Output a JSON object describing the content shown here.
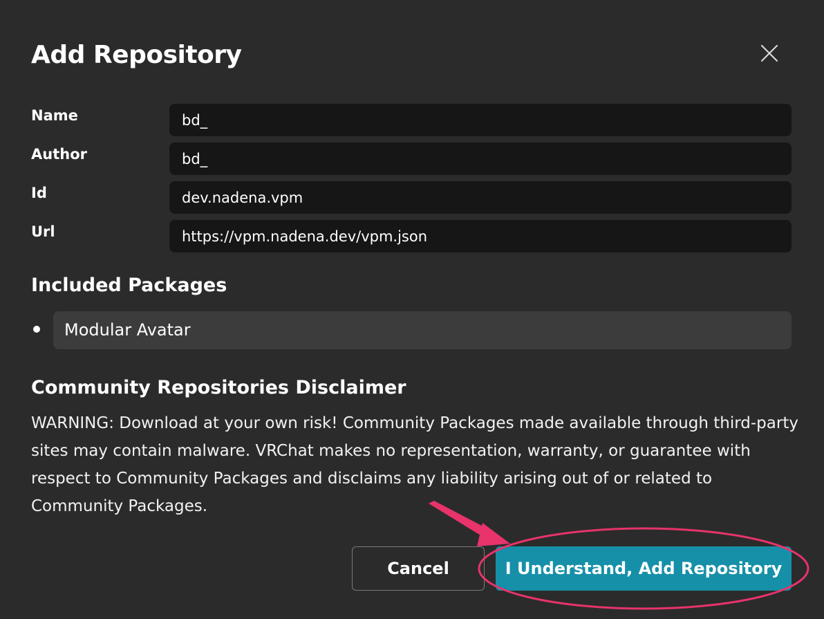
{
  "dialog": {
    "title": "Add Repository",
    "close_icon": "close-icon"
  },
  "fields": [
    {
      "label": "Name",
      "value": "bd_"
    },
    {
      "label": "Author",
      "value": "bd_"
    },
    {
      "label": "Id",
      "value": "dev.nadena.vpm"
    },
    {
      "label": "Url",
      "value": "https://vpm.nadena.dev/vpm.json"
    }
  ],
  "packages": {
    "heading": "Included Packages",
    "items": [
      "Modular Avatar"
    ]
  },
  "disclaimer": {
    "heading": "Community Repositories Disclaimer",
    "text": "WARNING: Download at your own risk! Community Packages made available through third-party sites may contain malware. VRChat makes no representation, warranty, or guarantee with respect to Community Packages and disclaims any liability arising out of or related to Community Packages."
  },
  "buttons": {
    "cancel": "Cancel",
    "confirm": "I Understand, Add Repository"
  },
  "colors": {
    "background": "#2b2b2b",
    "input_background": "#161616",
    "package_background": "#3c3c3c",
    "accent": "#1690a8",
    "annotation": "#e8336b"
  }
}
